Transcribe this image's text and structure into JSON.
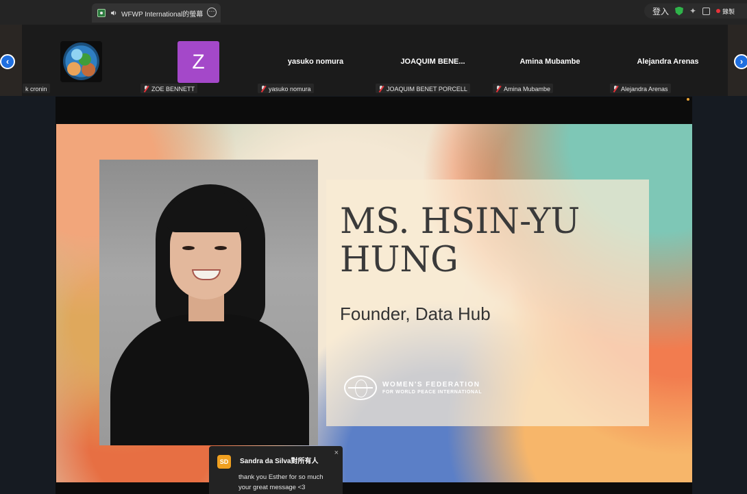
{
  "tab": {
    "title": "WFWP International的螢幕",
    "more_icon": "more-options-icon",
    "speaker_icon": "speaker-icon"
  },
  "topbar": {
    "login_label": "登入",
    "record_label": "錄製"
  },
  "participants": {
    "partial_label": "k cronin",
    "tiles": [
      {
        "name": "",
        "label": "ZOE BENNETT",
        "avatar_letter": "Z",
        "avatar_color": "#a448c9"
      },
      {
        "name": "yasuko nomura",
        "label": "yasuko nomura"
      },
      {
        "name": "JOAQUIM  BENE...",
        "label": "JOAQUIM BENET PORCELL"
      },
      {
        "name": "Amina Mubambe",
        "label": "Amina Mubambe"
      },
      {
        "name": "Alejandra Arenas",
        "label": "Alejandra Arenas"
      }
    ],
    "nav_prev": "‹",
    "nav_next": "›"
  },
  "slide": {
    "name_line1": "MS. HSIN-YU",
    "name_line2": "HUNG",
    "role": "Founder, Data Hub",
    "org_line1": "WOMEN'S FEDERATION",
    "org_line2": "FOR WORLD PEACE INTERNATIONAL"
  },
  "chat_toast": {
    "initials": "SD",
    "sender": "Sandra da Silva對所有人",
    "message": "thank you Esther for so much your great message <3",
    "close": "×"
  },
  "colors": {
    "accent_blue": "#1f6fe0",
    "record_red": "#e8333a",
    "shield_green": "#2fb34a",
    "sd_badge": "#f0a020"
  }
}
